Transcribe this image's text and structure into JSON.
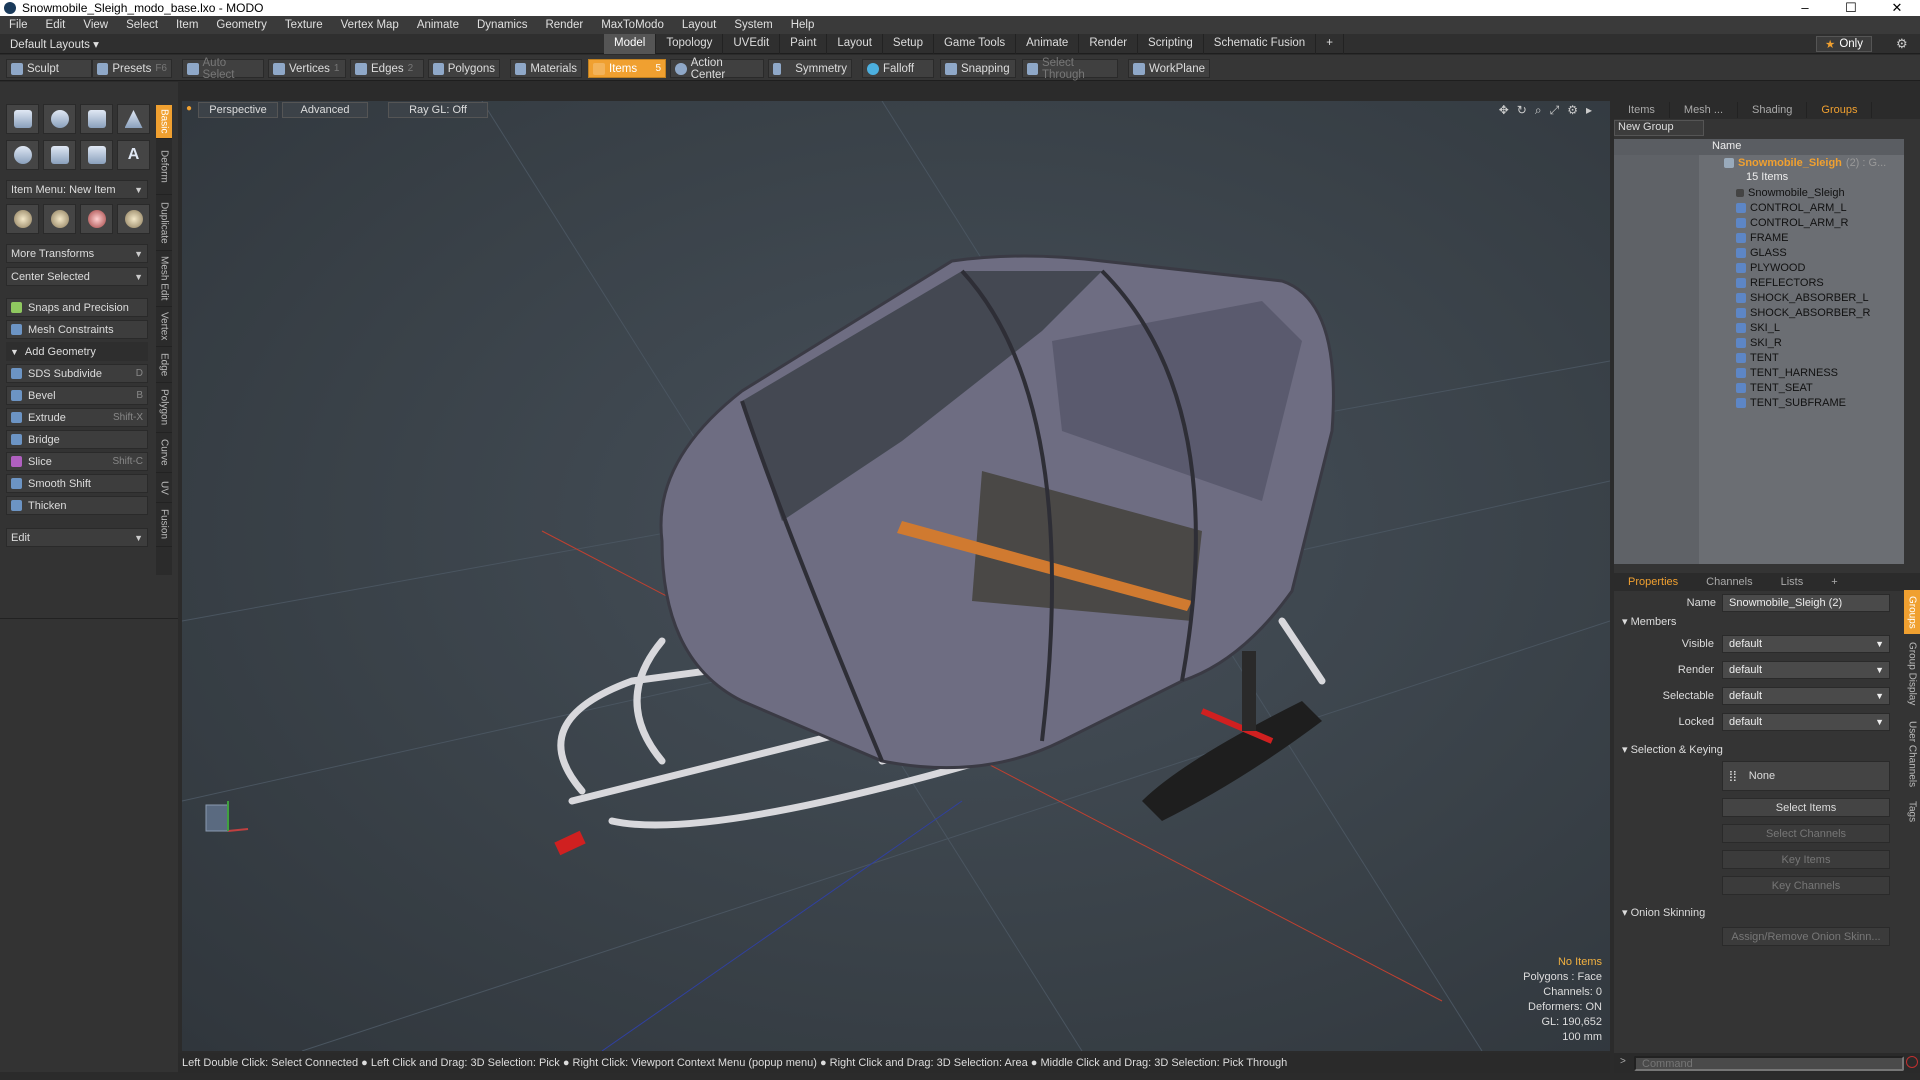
{
  "window": {
    "title": "Snowmobile_Sleigh_modo_base.lxo - MODO",
    "min": "–",
    "max": "☐",
    "close": "✕"
  },
  "menu": [
    "File",
    "Edit",
    "View",
    "Select",
    "Item",
    "Geometry",
    "Texture",
    "Vertex Map",
    "Animate",
    "Dynamics",
    "Render",
    "MaxToModo",
    "Layout",
    "System",
    "Help"
  ],
  "layout": {
    "label": "Default Layouts ▾",
    "tabs": [
      "Model",
      "Topology",
      "UVEdit",
      "Paint",
      "Layout",
      "Setup",
      "Game Tools",
      "Animate",
      "Render",
      "Scripting",
      "Schematic Fusion"
    ],
    "active_tab": "Model",
    "add": "+",
    "only": "Only"
  },
  "toolbar": {
    "sculpt": "Sculpt",
    "presets": "Presets",
    "presets_key": "F6",
    "auto_select": "Auto Select",
    "vertices": "Vertices",
    "vertices_n": "1",
    "edges": "Edges",
    "edges_n": "2",
    "polygons": "Polygons",
    "materials": "Materials",
    "items": "Items",
    "items_n": "5",
    "action_center": "Action Center",
    "symmetry": "Symmetry",
    "falloff": "Falloff",
    "snapping": "Snapping",
    "select_through": "Select Through",
    "workplane": "WorkPlane"
  },
  "left": {
    "item_menu": "Item Menu: New Item",
    "more_transforms": "More Transforms",
    "center_selected": "Center Selected",
    "snaps": "Snaps and Precision",
    "mesh_constraints": "Mesh Constraints",
    "add_geometry": "Add Geometry",
    "tools": [
      {
        "label": "SDS Subdivide",
        "key": "D"
      },
      {
        "label": "Bevel",
        "key": "B"
      },
      {
        "label": "Extrude",
        "key": "Shift-X"
      },
      {
        "label": "Bridge",
        "key": ""
      },
      {
        "label": "Slice",
        "key": "Shift-C"
      },
      {
        "label": "Smooth Shift",
        "key": ""
      },
      {
        "label": "Thicken",
        "key": ""
      }
    ],
    "edit": "Edit",
    "vtabs": [
      "Basic",
      "Deform",
      "Duplicate",
      "Mesh Edit",
      "Vertex",
      "Edge",
      "Polygon",
      "Curve",
      "UV",
      "Fusion"
    ]
  },
  "viewport": {
    "perspective": "Perspective",
    "advanced": "Advanced",
    "raygl": "Ray GL: Off",
    "stats": {
      "items": "No Items",
      "polygons": "Polygons : Face",
      "channels": "Channels: 0",
      "deformers": "Deformers: ON",
      "gl": "GL: 190,652",
      "scale": "100 mm"
    }
  },
  "status": "Left Double Click: Select Connected ● Left Click and Drag: 3D Selection: Pick ● Right Click: Viewport Context Menu (popup menu) ● Right Click and Drag: 3D Selection: Area ● Middle Click and Drag: 3D Selection: Pick Through",
  "right": {
    "tabs": [
      "Items",
      "Mesh ...",
      "Shading",
      "Groups"
    ],
    "active_tab": "Groups",
    "new_group": "New Group",
    "col_name": "Name",
    "root": "Snowmobile_Sleigh",
    "root_count": "(2) : G...",
    "items_count": "15 Items",
    "children": [
      "Snowmobile_Sleigh",
      "CONTROL_ARM_L",
      "CONTROL_ARM_R",
      "FRAME",
      "GLASS",
      "PLYWOOD",
      "REFLECTORS",
      "SHOCK_ABSORBER_L",
      "SHOCK_ABSORBER_R",
      "SKI_L",
      "SKI_R",
      "TENT",
      "TENT_HARNESS",
      "TENT_SEAT",
      "TENT_SUBFRAME"
    ],
    "props_tabs": [
      "Properties",
      "Channels",
      "Lists",
      "+"
    ],
    "props": {
      "name_label": "Name",
      "name_value": "Snowmobile_Sleigh (2)",
      "members": "Members",
      "visible": "Visible",
      "render": "Render",
      "selectable": "Selectable",
      "locked": "Locked",
      "default": "default",
      "sel_keying": "Selection & Keying",
      "none": "None",
      "select_items": "Select Items",
      "select_channels": "Select Channels",
      "key_items": "Key Items",
      "key_channels": "Key Channels",
      "onion": "Onion Skinning",
      "assign_onion": "Assign/Remove Onion Skinn..."
    },
    "rvtabs": [
      "Groups",
      "Group Display",
      "User Channels",
      "Tags"
    ]
  },
  "command": {
    "placeholder": "Command"
  }
}
